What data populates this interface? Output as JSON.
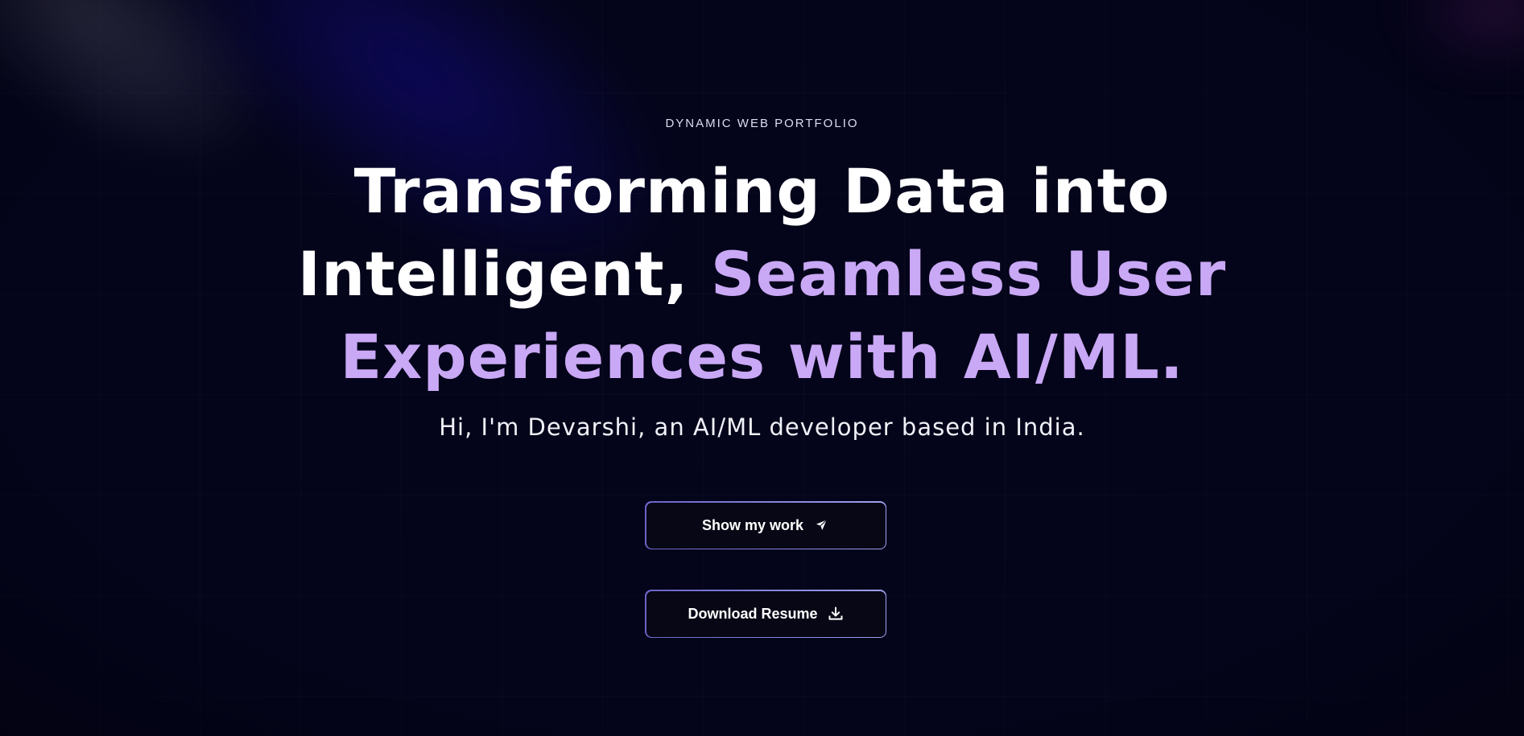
{
  "hero": {
    "eyebrow": "DYNAMIC WEB PORTFOLIO",
    "headline": {
      "line1": "Transforming Data into",
      "line2_plain": "Intelligent, ",
      "line2_accent": "Seamless User",
      "line3_accent": "Experiences with AI/ML."
    },
    "intro": "Hi, I'm Devarshi, an AI/ML developer based in India.",
    "buttons": {
      "show_work": {
        "label": "Show my work",
        "icon": "send-icon"
      },
      "download_resume": {
        "label": "Download Resume",
        "icon": "download-icon"
      }
    }
  },
  "colors": {
    "background": "#04041a",
    "accent_text": "#c9a8f5",
    "button_border_start": "#6a63c8",
    "button_border_end": "#9fa2f0",
    "button_fill": "#070716"
  }
}
